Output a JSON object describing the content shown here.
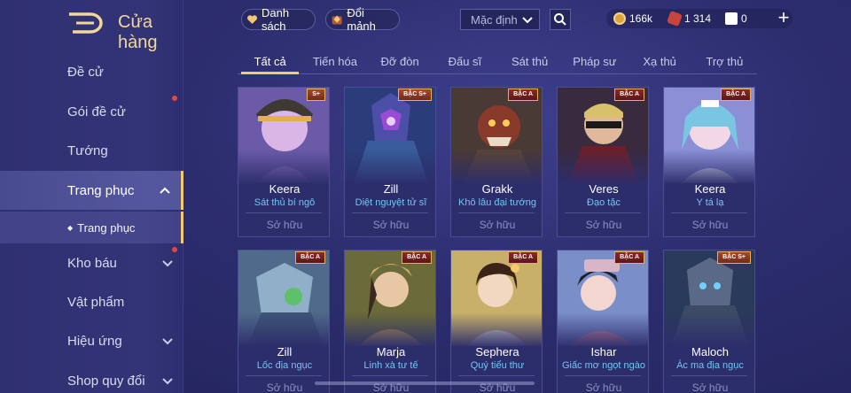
{
  "header": {
    "title": "Cửa hàng",
    "list_button": "Danh sách",
    "exchange_button": "Đổi mảnh",
    "sort_selected": "Mặc định",
    "gold": "166k",
    "vouchers": "1 314",
    "tokens": "0",
    "plus": "+"
  },
  "sidebar": {
    "items": [
      {
        "label": "Đề cử"
      },
      {
        "label": "Gói đề cử"
      },
      {
        "label": "Tướng"
      },
      {
        "label": "Trang phục"
      },
      {
        "label": "Kho báu"
      },
      {
        "label": "Vật phẩm"
      },
      {
        "label": "Hiệu ứng"
      },
      {
        "label": "Shop quy đổi"
      }
    ],
    "sub_item": "Trang phục"
  },
  "tabs": [
    "Tất cả",
    "Tiến hóa",
    "Đỡ đòn",
    "Đấu sĩ",
    "Sát thủ",
    "Pháp sư",
    "Xạ thủ",
    "Trợ thủ"
  ],
  "cards": [
    {
      "hero": "Keera",
      "skin": "Sát thủ bí ngô",
      "status": "Sở hữu",
      "badge": "S+"
    },
    {
      "hero": "Zill",
      "skin": "Diệt nguyệt tử sĩ",
      "status": "Sở hữu",
      "badge": "BẬC S+"
    },
    {
      "hero": "Grakk",
      "skin": "Khô lâu đại tướng",
      "status": "Sở hữu",
      "badge": "BẬC A"
    },
    {
      "hero": "Veres",
      "skin": "Đạo tặc",
      "status": "Sở hữu",
      "badge": "BẬC A"
    },
    {
      "hero": "Keera",
      "skin": "Y tá lạ",
      "status": "Sở hữu",
      "badge": "BẬC A"
    },
    {
      "hero": "Zill",
      "skin": "Lốc địa ngục",
      "status": "Sở hữu",
      "badge": "BẬC A"
    },
    {
      "hero": "Marja",
      "skin": "Linh xà tư tế",
      "status": "Sở hữu",
      "badge": "BẬC A"
    },
    {
      "hero": "Sephera",
      "skin": "Quý tiểu thư",
      "status": "Sở hữu",
      "badge": "BẬC A"
    },
    {
      "hero": "Ishar",
      "skin": "Giấc mơ ngọt ngào",
      "status": "Sở hữu",
      "badge": "BẬC A"
    },
    {
      "hero": "Maloch",
      "skin": "Ác ma địa ngục",
      "status": "Sở hữu",
      "badge": "BẬC S+"
    }
  ],
  "colors": {
    "accent_gold": "#f3c972",
    "skin_name_blue": "#6ec8f5",
    "background": "#2c2d6e"
  }
}
